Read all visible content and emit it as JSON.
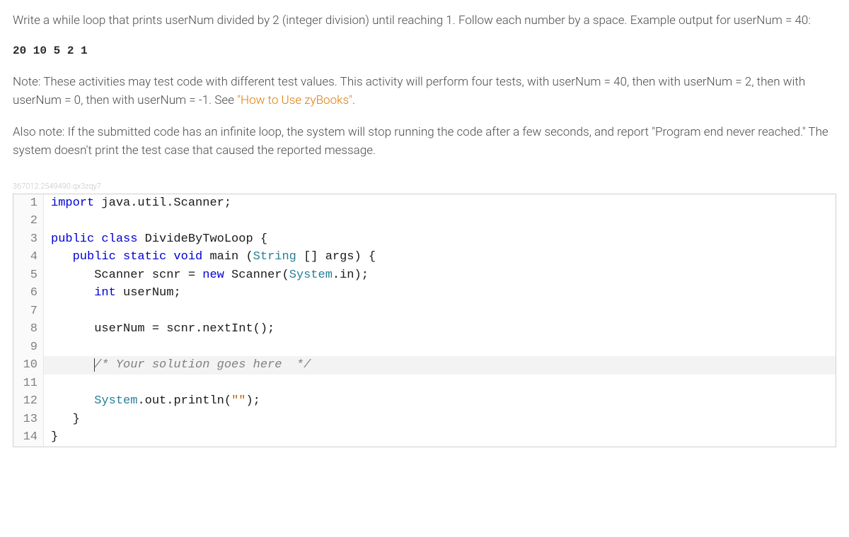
{
  "prompt": {
    "p1": "Write a while loop that prints userNum divided by 2 (integer division) until reaching 1. Follow each number by a space. Example output for userNum = 40:",
    "example": "20 10 5 2 1",
    "p2a": "Note: These activities may test code with different test values. This activity will perform four tests, with userNum = 40, then with userNum = 2, then with userNum = 0, then with userNum = -1. See ",
    "link": "\"How to Use zyBooks\"",
    "p2b": ".",
    "p3": "Also note: If the submitted code has an infinite loop, the system will stop running the code after a few seconds, and report \"Program end never reached.\" The system doesn't print the test case that caused the reported message."
  },
  "trace_id": "367012.2549490.qx3zqy7",
  "code": {
    "lines": [
      {
        "n": 1,
        "tokens": [
          [
            "kw",
            "import"
          ],
          [
            "id",
            " java.util.Scanner;"
          ]
        ]
      },
      {
        "n": 2,
        "tokens": []
      },
      {
        "n": 3,
        "tokens": [
          [
            "kw",
            "public class"
          ],
          [
            "id",
            " DivideByTwoLoop {"
          ]
        ]
      },
      {
        "n": 4,
        "tokens": [
          [
            "id",
            "   "
          ],
          [
            "kw",
            "public static void"
          ],
          [
            "id",
            " main ("
          ],
          [
            "type",
            "String"
          ],
          [
            "id",
            " [] args) {"
          ]
        ]
      },
      {
        "n": 5,
        "tokens": [
          [
            "id",
            "      Scanner scnr = "
          ],
          [
            "kw",
            "new"
          ],
          [
            "id",
            " Scanner("
          ],
          [
            "type",
            "System"
          ],
          [
            "id",
            ".in);"
          ]
        ]
      },
      {
        "n": 6,
        "tokens": [
          [
            "id",
            "      "
          ],
          [
            "kw",
            "int"
          ],
          [
            "id",
            " userNum;"
          ]
        ]
      },
      {
        "n": 7,
        "tokens": []
      },
      {
        "n": 8,
        "tokens": [
          [
            "id",
            "      userNum = scnr.nextInt();"
          ]
        ]
      },
      {
        "n": 9,
        "tokens": []
      },
      {
        "n": 10,
        "solution": true,
        "tokens": [
          [
            "id",
            "      "
          ],
          [
            "cmt",
            "/* Your solution goes here  */"
          ]
        ]
      },
      {
        "n": 11,
        "tokens": []
      },
      {
        "n": 12,
        "tokens": [
          [
            "id",
            "      "
          ],
          [
            "type",
            "System"
          ],
          [
            "id",
            ".out.println("
          ],
          [
            "str",
            "\"\""
          ],
          [
            "id",
            ");"
          ]
        ]
      },
      {
        "n": 13,
        "tokens": [
          [
            "id",
            "   }"
          ]
        ]
      },
      {
        "n": 14,
        "tokens": [
          [
            "id",
            "}"
          ]
        ]
      }
    ]
  }
}
